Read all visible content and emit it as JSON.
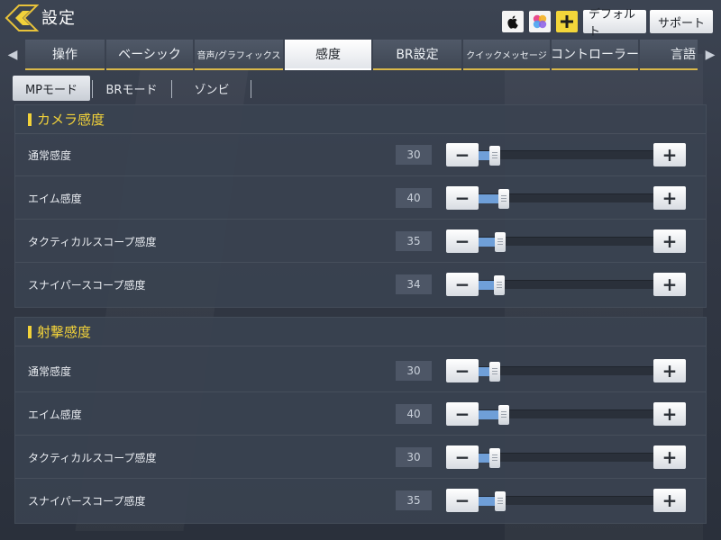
{
  "header": {
    "title": "設定",
    "icons": [
      "back-arrow-icon",
      "apple-icon",
      "game-center-icon",
      "plus-icon"
    ],
    "default_label": "デフォルト",
    "support_label": "サポート"
  },
  "tabs": [
    {
      "label": "操作"
    },
    {
      "label": "ベーシック"
    },
    {
      "label": "音声/グラフィックス"
    },
    {
      "label": "感度"
    },
    {
      "label": "BR設定"
    },
    {
      "label": "クイックメッセージ"
    },
    {
      "label": "コントローラー"
    },
    {
      "label": "言語"
    }
  ],
  "active_tab": "感度",
  "modes": [
    {
      "label": "MPモード"
    },
    {
      "label": "BRモード"
    },
    {
      "label": "ゾンビ"
    }
  ],
  "active_mode": "MPモード",
  "sections": [
    {
      "title": "カメラ感度",
      "rows": [
        {
          "label": "通常感度",
          "value": "30",
          "fraction": 0.03
        },
        {
          "label": "エイム感度",
          "value": "40",
          "fraction": 0.08
        },
        {
          "label": "タクティカルスコープ感度",
          "value": "35",
          "fraction": 0.06
        },
        {
          "label": "スナイパースコープ感度",
          "value": "34",
          "fraction": 0.055
        }
      ]
    },
    {
      "title": "射撃感度",
      "rows": [
        {
          "label": "通常感度",
          "value": "30",
          "fraction": 0.03
        },
        {
          "label": "エイム感度",
          "value": "40",
          "fraction": 0.08
        },
        {
          "label": "タクティカルスコープ感度",
          "value": "30",
          "fraction": 0.03
        },
        {
          "label": "スナイパースコープ感度",
          "value": "35",
          "fraction": 0.06
        }
      ]
    }
  ],
  "colors": {
    "accent_yellow": "#f2d23a",
    "slider_fill": "#6f9fd8",
    "panel": "#3a4250"
  }
}
